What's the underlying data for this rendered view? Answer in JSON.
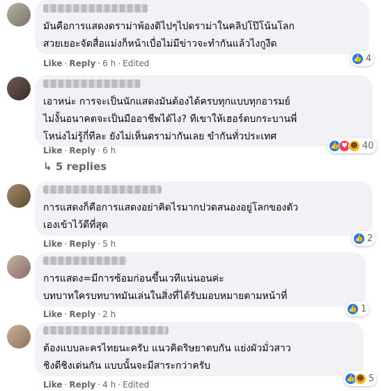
{
  "comments": [
    {
      "text": "มันคือการแสดงดราม่าพ้องดิไปๆไปดราม่าในคลิปโป๊โน้นโลก\nสวยเยอะจัดสื่อแม่งก็หน้าเบื่อไม่มีข่าวจะทำกันแล้วไงกูงืด",
      "like": "Like",
      "reply": "Reply",
      "time": "6 h",
      "edited": "Edited",
      "reactions": [
        "like-icon"
      ],
      "count": "4"
    },
    {
      "text": "เอาหน่ะ การจะเป็นนักแสดงมันต้องได้ครบทุกแบบทุกอารมย์\nไม่งั้นอนาคตจะเป็นมืออาชีพได้ไง? ทีเขาให้เฮอร์ตบกระบานพี่\nโหน่งไม่รู้กี่ทีละ ยังไม่เห็นดราม่ากันเลย ขำกันทั่วประเทศ",
      "like": "Like",
      "reply": "Reply",
      "time": "6 h",
      "reactions": [
        "like-icon",
        "love-icon",
        "haha-icon"
      ],
      "count": "40",
      "replies": "5 replies"
    },
    {
      "text": "การแสดงก็คือการแสดงอย่าคิดไรมากปวดสนองอยู่โลกของตัว\nเองเข้าไว้ดีที่สุด",
      "like": "Like",
      "reply": "Reply",
      "time": "5 h",
      "reactions": [
        "like-icon"
      ],
      "count": "2"
    },
    {
      "text": "การแสดง=มีการซ้อมก่อนขึ้นเวทีแน่นอนค่ะ\nบทบาทใครบทบาทมันเล่นในสิ่งที่ได้รับมอบหมายตามหน้าที่",
      "like": "Like",
      "reply": "Reply",
      "time": "2 h",
      "reactions": [
        "like-icon"
      ],
      "count": "1"
    },
    {
      "text": "ต้องแบบละครไทยนะครับ แนวคิดริษยาตบกัน แย่งผัวมั่วสาว\nชิงดีชิงเด่นกัน แบบนั้นจะมีสาระกว่าครับ",
      "like": "Like",
      "reply": "Reply",
      "time": "4 h",
      "edited": "Edited",
      "reactions": [
        "like-icon",
        "haha-icon"
      ],
      "count": "5"
    }
  ]
}
